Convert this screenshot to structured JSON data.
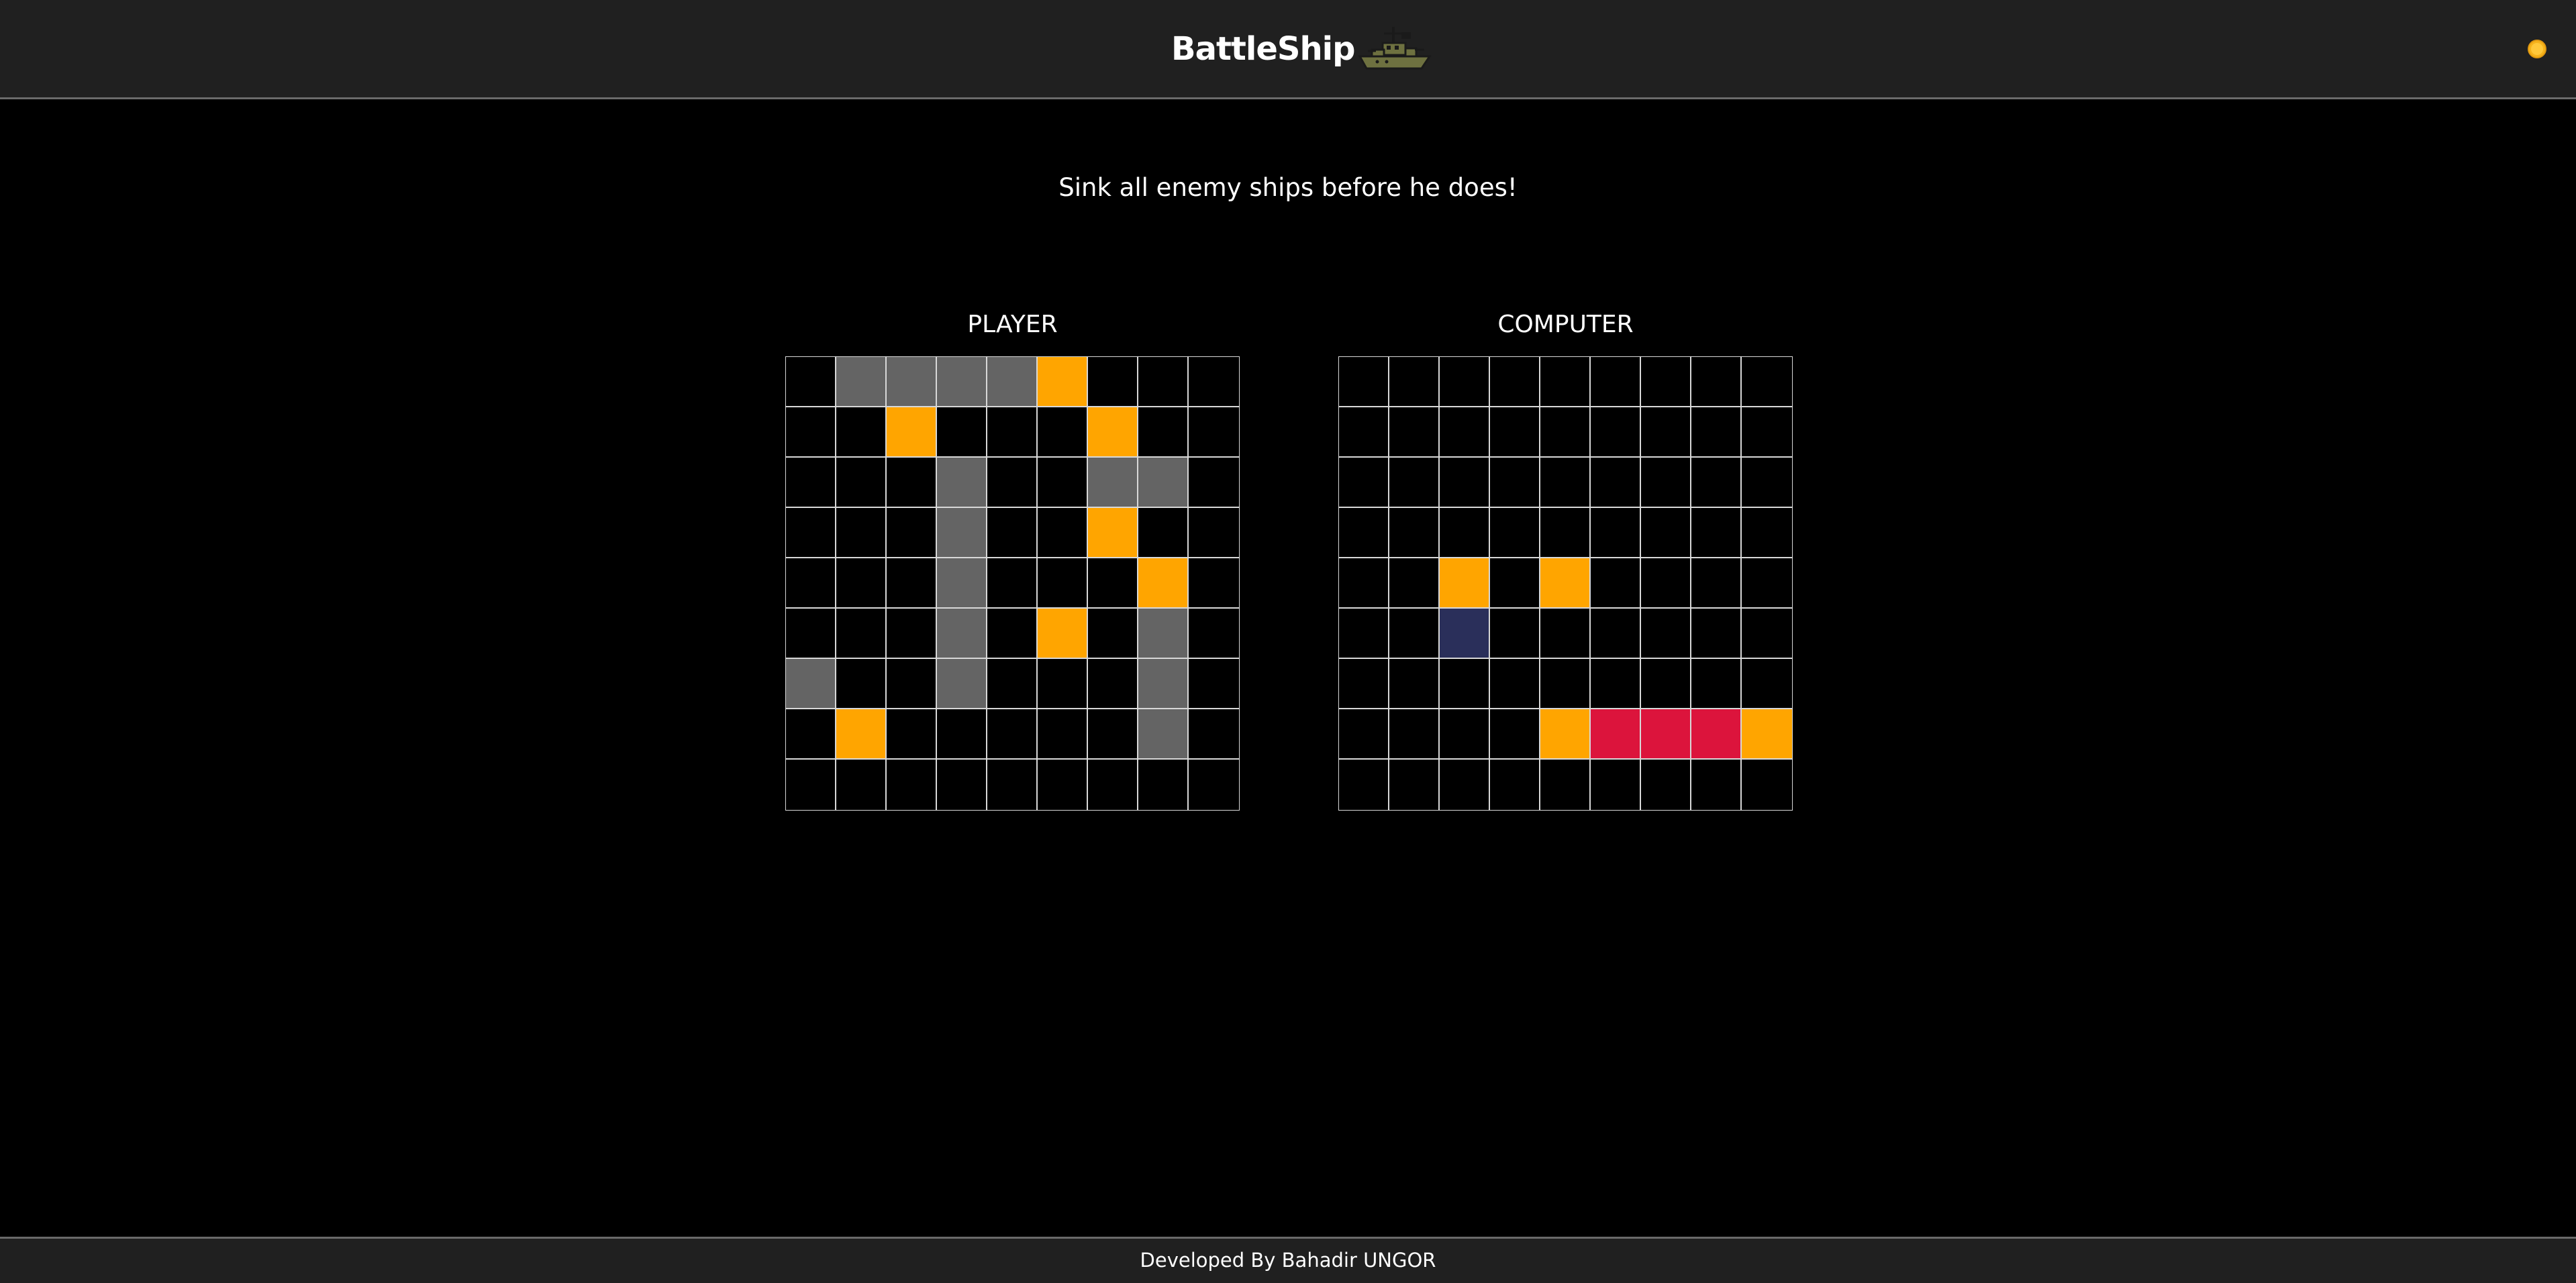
{
  "header": {
    "title": "BattleShip",
    "logo_icon": "battleship-icon",
    "theme_toggle_icon": "sun-icon"
  },
  "subtitle": "Sink all enemy ships before he does!",
  "colors": {
    "empty": "#000000",
    "ship": "#646464",
    "miss": "#FFA500",
    "hit": "#DC143C",
    "selected": "#2A2F5A",
    "grid_line": "#D8D8D8",
    "bar": "#202020",
    "sun": "#F5B21B"
  },
  "legend_codes": {
    "empty": ".",
    "ship": "S",
    "miss": "M",
    "hit": "H",
    "selected": "B"
  },
  "boards": {
    "player": {
      "label": "PLAYER",
      "rows": [
        ".SSSSM...",
        "..M...M..",
        "...S..SS.",
        "...S..M..",
        "...S...M.",
        "...S.M.S.",
        "S..S...S.",
        ".M.....S.",
        "........."
      ]
    },
    "computer": {
      "label": "COMPUTER",
      "rows": [
        ".........",
        ".........",
        ".........",
        ".........",
        "..M.M....",
        "..B......",
        ".........",
        "....MHHHM",
        "........."
      ]
    }
  },
  "footer": {
    "credit": "Developed By Bahadir UNGOR"
  }
}
